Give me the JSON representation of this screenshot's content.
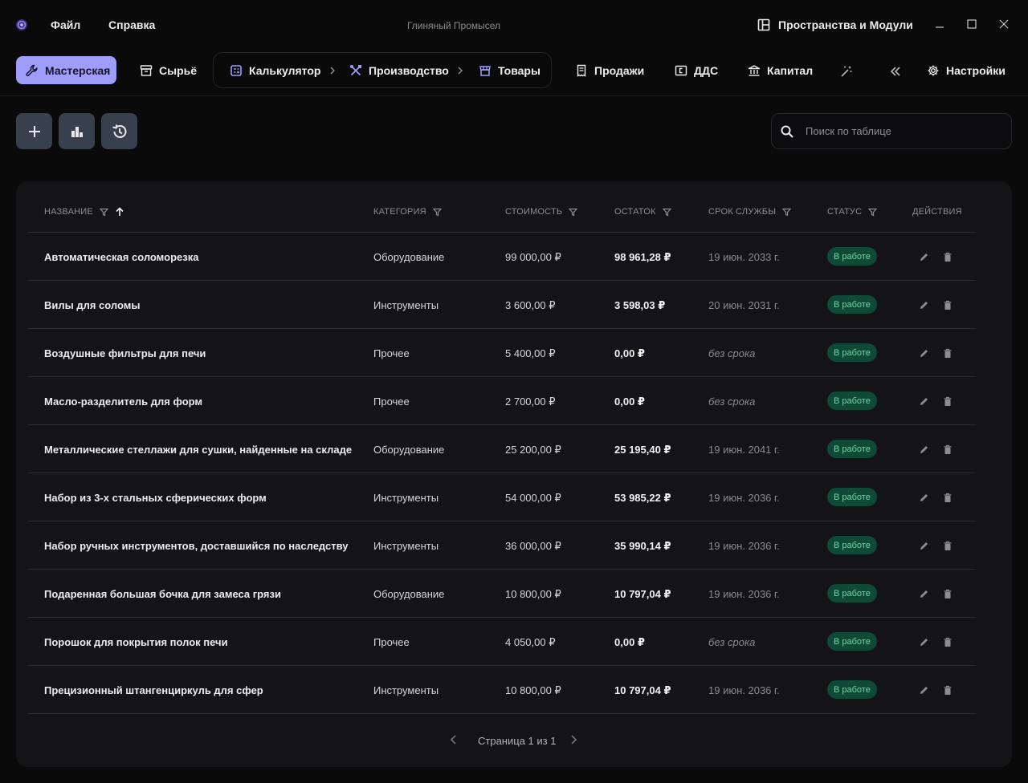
{
  "window": {
    "title": "Глиняный Промысел",
    "menu": [
      "Файл",
      "Справка"
    ],
    "spaces_label": "Пространства и Модули"
  },
  "nav": {
    "workshop": "Мастерская",
    "raw": "Сырьё",
    "calculator": "Калькулятор",
    "production": "Производство",
    "goods": "Товары",
    "sales": "Продажи",
    "dds": "ДДС",
    "capital": "Капитал",
    "settings": "Настройки"
  },
  "search": {
    "placeholder": "Поиск по таблице"
  },
  "table": {
    "headers": {
      "name": "НАЗВАНИЕ",
      "category": "КАТЕГОРИЯ",
      "cost": "СТОИМОСТЬ",
      "rest": "ОСТАТОК",
      "life": "СРОК СЛУЖБЫ",
      "status": "СТАТУС",
      "actions": "ДЕЙСТВИЯ"
    },
    "rows": [
      {
        "name": "Автоматическая соломорезка",
        "category": "Оборудование",
        "cost": "99 000,00 ₽",
        "rest": "98 961,28 ₽",
        "life": "19 июн. 2033 г.",
        "status": "В работе"
      },
      {
        "name": "Вилы для соломы",
        "category": "Инструменты",
        "cost": "3 600,00 ₽",
        "rest": "3 598,03 ₽",
        "life": "20 июн. 2031 г.",
        "status": "В работе"
      },
      {
        "name": "Воздушные фильтры для печи",
        "category": "Прочее",
        "cost": "5 400,00 ₽",
        "rest": "0,00 ₽",
        "life": "без срока",
        "status": "В работе"
      },
      {
        "name": "Масло-разделитель для форм",
        "category": "Прочее",
        "cost": "2 700,00 ₽",
        "rest": "0,00 ₽",
        "life": "без срока",
        "status": "В работе"
      },
      {
        "name": "Металлические стеллажи для сушки, найденные на складе",
        "category": "Оборудование",
        "cost": "25 200,00 ₽",
        "rest": "25 195,40 ₽",
        "life": "19 июн. 2041 г.",
        "status": "В работе"
      },
      {
        "name": "Набор из 3-х стальных сферических форм",
        "category": "Инструменты",
        "cost": "54 000,00 ₽",
        "rest": "53 985,22 ₽",
        "life": "19 июн. 2036 г.",
        "status": "В работе"
      },
      {
        "name": "Набор ручных инструментов, доставшийся по наследству",
        "category": "Инструменты",
        "cost": "36 000,00 ₽",
        "rest": "35 990,14 ₽",
        "life": "19 июн. 2036 г.",
        "status": "В работе"
      },
      {
        "name": "Подаренная большая бочка для замеса грязи",
        "category": "Оборудование",
        "cost": "10 800,00 ₽",
        "rest": "10 797,04 ₽",
        "life": "19 июн. 2036 г.",
        "status": "В работе"
      },
      {
        "name": "Порошок для покрытия полок печи",
        "category": "Прочее",
        "cost": "4 050,00 ₽",
        "rest": "0,00 ₽",
        "life": "без срока",
        "status": "В работе"
      },
      {
        "name": "Прецизионный штангенциркуль для сфер",
        "category": "Инструменты",
        "cost": "10 800,00 ₽",
        "rest": "10 797,04 ₽",
        "life": "19 июн. 2036 г.",
        "status": "В работе"
      }
    ]
  },
  "pagination": {
    "label": "Страница 1 из 1"
  },
  "colors": {
    "accent": "#9f9dfa",
    "badge_bg": "#0f4a37",
    "badge_text": "#69d8a6",
    "tool_btn": "#39404d"
  }
}
